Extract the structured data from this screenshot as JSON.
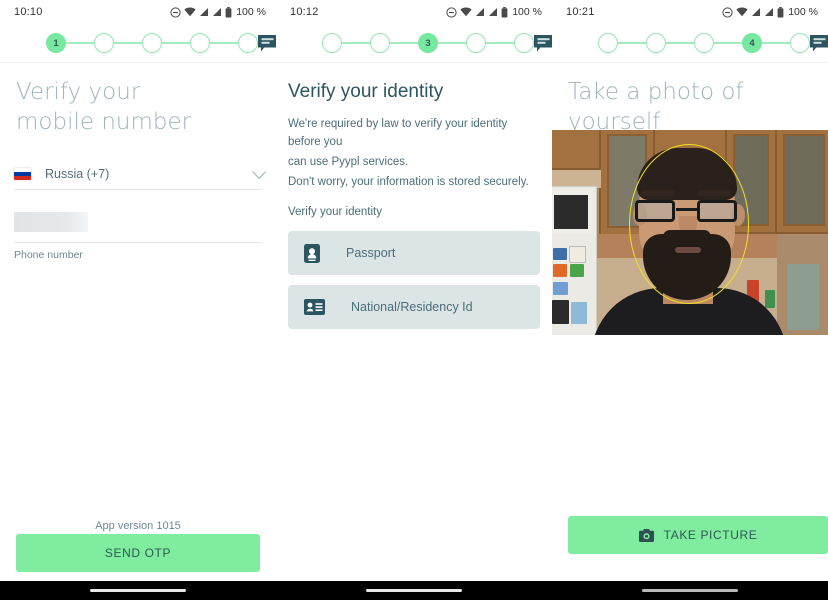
{
  "app": {
    "brand_green": "#7fec9f",
    "step_green": "#77e8a0",
    "dark_teal": "#2d5561",
    "muted_title": "#9db4bd",
    "face_oval_color": "#f2e020"
  },
  "panels": [
    {
      "id": "verify-mobile-number",
      "status_bar": {
        "time": "10:10",
        "battery_text": "100 %",
        "icons": [
          "do-not-disturb-icon",
          "wifi-icon",
          "signal-icon",
          "signal-icon",
          "battery-icon"
        ]
      },
      "stepper": {
        "total": 5,
        "active": 1,
        "labels": [
          "1",
          "",
          "",
          "",
          ""
        ],
        "chat_icon": "chat-icon"
      },
      "title": "Verify your\nmobile number",
      "title_lines": [
        "Verify your",
        "mobile number"
      ],
      "country_select": {
        "label": "Russia (+7)",
        "flag": "russia-flag-icon",
        "chevron": "chevron-down-icon"
      },
      "phone_input": {
        "value": "",
        "placeholder": "",
        "label": "Phone number",
        "redacted": true
      },
      "app_version": "App version 1015",
      "primary_button": "SEND OTP"
    },
    {
      "id": "verify-identity",
      "status_bar": {
        "time": "10:12",
        "battery_text": "100 %"
      },
      "stepper": {
        "total": 5,
        "active": 3,
        "labels": [
          "",
          "",
          "3",
          "",
          ""
        ],
        "chat_icon": "chat-icon"
      },
      "title": "Verify your identity",
      "body": [
        "We're required by law to verify your identity before you",
        "can use Pyypl services.",
        "Don't worry, your information is stored securely."
      ],
      "section_label": "Verify your identity",
      "options": [
        {
          "label": "Passport",
          "icon": "passport-icon"
        },
        {
          "label": "National/Residency Id",
          "icon": "id-card-icon"
        }
      ]
    },
    {
      "id": "take-photo",
      "status_bar": {
        "time": "10:21",
        "battery_text": "100 %"
      },
      "stepper": {
        "total": 5,
        "active": 4,
        "labels": [
          "",
          "",
          "",
          "4",
          ""
        ],
        "chat_icon": "chat-icon"
      },
      "title": "Take a photo of yourself",
      "camera": {
        "face_guide": "face-oval-guide",
        "alt": "live camera preview of a bearded man with glasses in a kitchen"
      },
      "primary_button": "TAKE PICTURE",
      "primary_button_icon": "camera-icon"
    }
  ]
}
